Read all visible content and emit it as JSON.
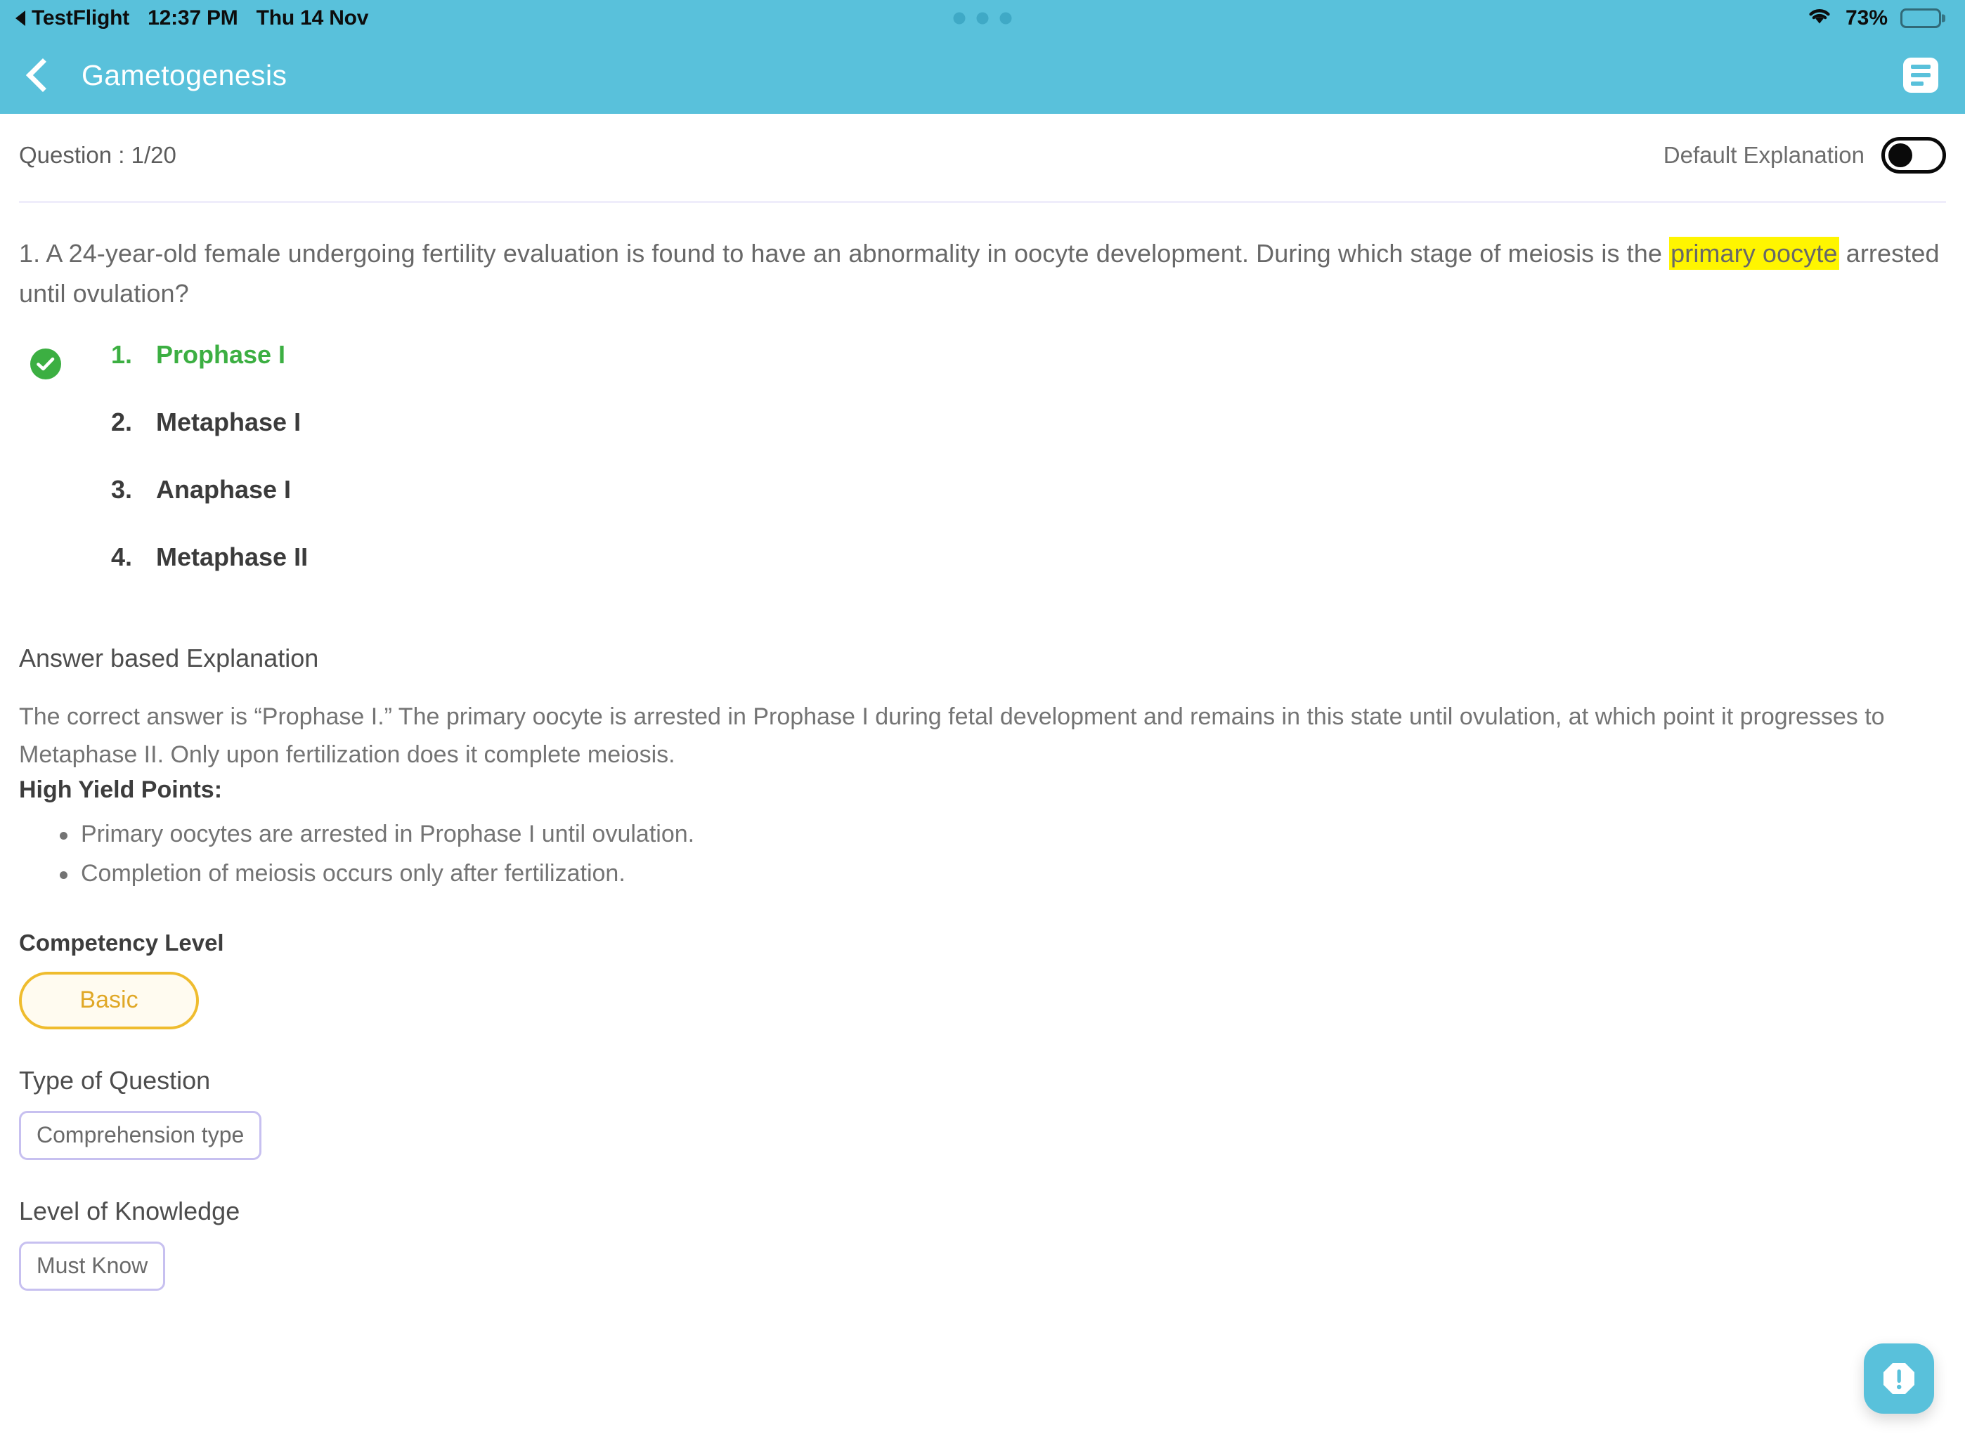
{
  "status_bar": {
    "app_name": "TestFlight",
    "time": "12:37 PM",
    "date": "Thu 14 Nov",
    "battery_percent": "73%",
    "wifi_icon": "wifi-icon",
    "battery_icon": "battery-icon",
    "back_arrow_icon": "back-triangle-icon",
    "dots_icon": "three-dots-indicator"
  },
  "header": {
    "back_icon": "chevron-left-icon",
    "title": "Gametogenesis",
    "menu_icon": "list-lines-icon"
  },
  "question_bar": {
    "counter": "Question : 1/20",
    "toggle_label": "Default Explanation",
    "toggle_state": "off",
    "toggle_icon": "toggle-switch-icon"
  },
  "question": {
    "lead": "1. A 24-year-old female undergoing fertility evaluation is found to have an abnormality in oocyte development. During which stage of meiosis is the ",
    "highlight": "primary oocyte",
    "highlight_color": "#FFF500",
    "tail": " arrested until ovulation?"
  },
  "options": [
    {
      "num": "1.",
      "text": "Prophase I",
      "correct": true,
      "icon": "check-circle-icon"
    },
    {
      "num": "2.",
      "text": "Metaphase I",
      "correct": false
    },
    {
      "num": "3.",
      "text": "Anaphase I",
      "correct": false
    },
    {
      "num": "4.",
      "text": "Metaphase II",
      "correct": false
    }
  ],
  "explanation": {
    "heading": "Answer based Explanation",
    "body": "The correct answer is “Prophase I.” The primary oocyte is arrested in Prophase I during fetal development and remains in this state until ovulation, at which point it progresses to Metaphase II. Only upon fertilization does it complete meiosis.",
    "high_yield_title": "High Yield Points:",
    "high_yield_points": [
      "Primary oocytes are arrested in Prophase I until ovulation.",
      "Completion of meiosis occurs only after fertilization."
    ]
  },
  "meta": {
    "competency_label": "Competency Level",
    "competency_value": "Basic",
    "competency_color": "#E0A827",
    "type_label": "Type of Question",
    "type_value": "Comprehension type",
    "knowledge_label": "Level of Knowledge",
    "knowledge_value": "Must Know"
  },
  "fab": {
    "icon": "alert-octagon-icon",
    "color": "#59C1DB"
  },
  "theme": {
    "accent": "#59C1DB",
    "correct_green": "#3CAF42",
    "highlight_yellow": "#FFF500",
    "field_border": "#C7C0F0"
  }
}
